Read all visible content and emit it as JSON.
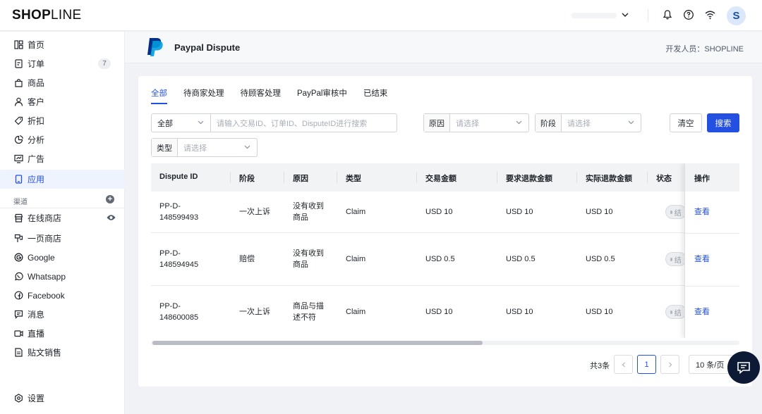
{
  "topbar": {
    "logo": {
      "bold": "SHOP",
      "thin": "LINE"
    },
    "avatar_initial": "S",
    "icons": [
      "chevron-down-icon",
      "bell-icon",
      "help-icon",
      "wifi-icon"
    ]
  },
  "sidebar": {
    "items": [
      {
        "label": "首页",
        "icon": "dashboard-icon"
      },
      {
        "label": "订单",
        "icon": "order-icon",
        "badge": "7"
      },
      {
        "label": "商品",
        "icon": "bag-icon"
      },
      {
        "label": "客户",
        "icon": "user-icon"
      },
      {
        "label": "折扣",
        "icon": "tag-icon"
      },
      {
        "label": "分析",
        "icon": "chart-icon"
      },
      {
        "label": "广告",
        "icon": "ads-icon"
      },
      {
        "label": "应用",
        "icon": "app-icon",
        "active": true
      }
    ],
    "channels_title": "渠道",
    "channels": [
      {
        "label": "在线商店",
        "icon": "store-icon"
      },
      {
        "label": "一页商店",
        "icon": "onepage-icon"
      },
      {
        "label": "Google",
        "icon": "google-icon"
      },
      {
        "label": "Whatsapp",
        "icon": "whatsapp-icon"
      },
      {
        "label": "Facebook",
        "icon": "facebook-icon"
      },
      {
        "label": "消息",
        "icon": "message-icon"
      },
      {
        "label": "直播",
        "icon": "live-icon"
      },
      {
        "label": "贴文销售",
        "icon": "post-icon"
      }
    ],
    "settings_label": "设置"
  },
  "header": {
    "title": "Paypal Dispute",
    "developer": "开发人员：SHOPLINE"
  },
  "tabs": [
    "全部",
    "待商家处理",
    "待顾客处理",
    "PayPal审核中",
    "已结束"
  ],
  "filters": {
    "scope_value": "全部",
    "search_placeholder": "请输入交易ID、订单ID、DisputeID进行搜索",
    "reason_label": "原因",
    "reason_placeholder": "请选择",
    "stage_label": "阶段",
    "stage_placeholder": "请选择",
    "type_label": "类型",
    "type_placeholder": "请选择",
    "clear_label": "清空",
    "search_label": "搜索"
  },
  "table": {
    "columns": [
      "Dispute ID",
      "阶段",
      "原因",
      "类型",
      "交易金额",
      "要求退款金额",
      "实际退款金额",
      "状态",
      "操作"
    ],
    "rows": [
      {
        "id_line1": "PP-D-",
        "id_line2": "148599493",
        "stage": "一次上诉",
        "reason_line1": "没有收到",
        "reason_line2": "商品",
        "type": "Claim",
        "amount": "USD 10",
        "requested": "USD 10",
        "actual": "USD 10",
        "status": "已结束",
        "action": "查看"
      },
      {
        "id_line1": "PP-D-",
        "id_line2": "148594945",
        "stage": "赔偿",
        "reason_line1": "没有收到",
        "reason_line2": "商品",
        "type": "Claim",
        "amount": "USD 0.5",
        "requested": "USD 0.5",
        "actual": "USD 0.5",
        "status": "已结束",
        "action": "查看"
      },
      {
        "id_line1": "PP-D-",
        "id_line2": "148600085",
        "stage": "一次上诉",
        "reason_line1": "商品与描",
        "reason_line2": "述不符",
        "type": "Claim",
        "amount": "USD 10",
        "requested": "USD 10",
        "actual": "USD 10",
        "status": "已结束",
        "action": "查看"
      }
    ]
  },
  "pagination": {
    "total": "共3条",
    "current_page": "1",
    "page_size": "10 条/页"
  },
  "colors": {
    "accent": "#2350e0",
    "paypal_dark": "#003087",
    "paypal_light": "#009cde",
    "fab": "#0c1a35"
  }
}
